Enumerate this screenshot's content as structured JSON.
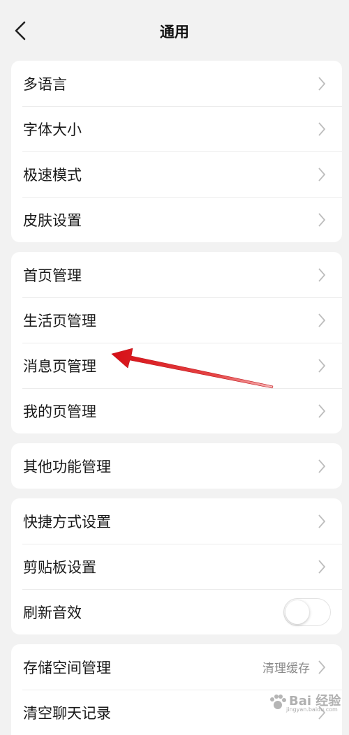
{
  "header": {
    "title": "通用",
    "back_icon": "back-arrow-icon"
  },
  "groups": [
    {
      "items": [
        {
          "label": "多语言"
        },
        {
          "label": "字体大小"
        },
        {
          "label": "极速模式"
        },
        {
          "label": "皮肤设置"
        }
      ]
    },
    {
      "items": [
        {
          "label": "首页管理"
        },
        {
          "label": "生活页管理"
        },
        {
          "label": "消息页管理"
        },
        {
          "label": "我的页管理"
        }
      ]
    },
    {
      "items": [
        {
          "label": "其他功能管理"
        }
      ]
    },
    {
      "items": [
        {
          "label": "快捷方式设置"
        },
        {
          "label": "剪贴板设置"
        },
        {
          "label": "刷新音效",
          "toggle_on": false
        }
      ]
    },
    {
      "items": [
        {
          "label": "存储空间管理",
          "value": "清理缓存"
        },
        {
          "label": "清空聊天记录"
        }
      ]
    }
  ],
  "annotation": {
    "color": "#e0161b",
    "points_to": "消息页管理"
  },
  "watermark": {
    "text": "Bai 经验",
    "sub": "jingyan.baidu.com"
  }
}
